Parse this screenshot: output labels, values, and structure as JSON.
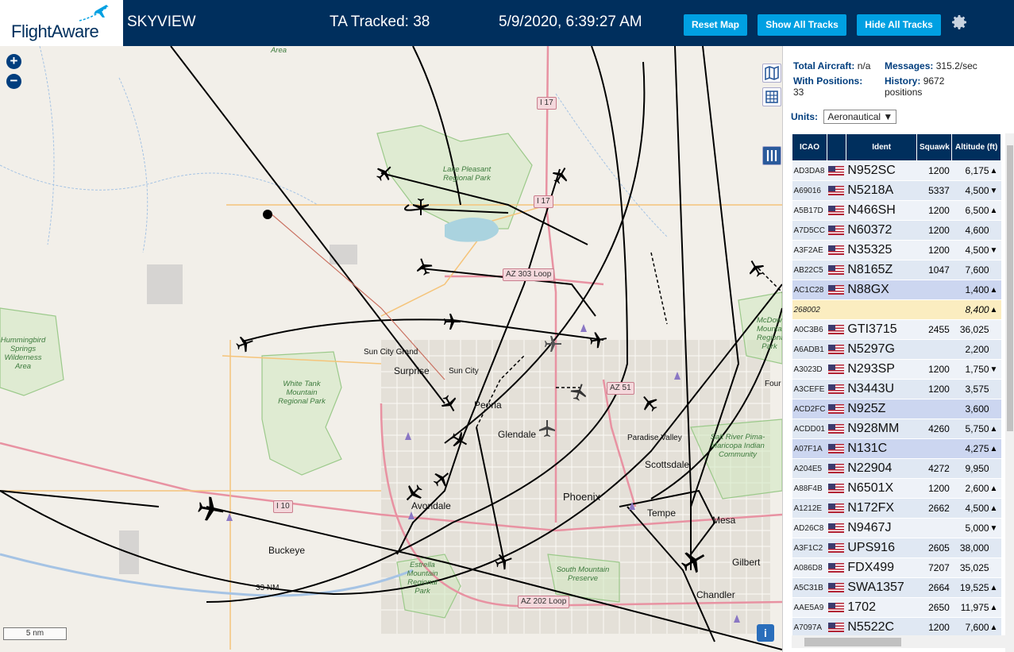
{
  "header": {
    "logo_text": "FlightAware",
    "app_title": "SKYVIEW",
    "tracked": "TA Tracked: 38",
    "datetime": "5/9/2020, 6:39:27 AM",
    "buttons": {
      "reset": "Reset Map",
      "show_all": "Show All Tracks",
      "hide_all": "Hide All Tracks"
    }
  },
  "map": {
    "zoom_in": "+",
    "zoom_out": "−",
    "scale_label": "5 nm",
    "range_label": "33 NM",
    "info": "i",
    "places": [
      "Surprise",
      "Sun City",
      "Sun City Grand",
      "Peoria",
      "Glendale",
      "Phoenix",
      "Tempe",
      "Mesa",
      "Scottsdale",
      "Paradise Valley",
      "Gilbert",
      "Chandler",
      "Buckeye",
      "Avondale",
      "Four"
    ],
    "parks": [
      "Lake Pleasant Regional Park",
      "White Tank Mountain Regional Park",
      "Hummingbird Springs Wilderness Area",
      "Estrella Mountain Regional Park",
      "South Mountain Preserve",
      "Salt River Pima-Maricopa Indian Community",
      "McDowell Mountain Regional Park",
      "Area"
    ],
    "roads": [
      "I 17",
      "I 17",
      "AZ 303 Loop",
      "AZ 51",
      "I 10",
      "AZ 202 Loop"
    ]
  },
  "panel": {
    "total_aircraft_label": "Total Aircraft:",
    "total_aircraft_value": "n/a",
    "messages_label": "Messages:",
    "messages_value": "315.2/sec",
    "with_positions_label": "With Positions:",
    "with_positions_value": "33",
    "history_label": "History:",
    "history_value": "9672 positions",
    "units_label": "Units:",
    "units_value": "Aeronautical ▼",
    "columns": [
      "ICAO",
      "Ident",
      "Squawk",
      "Altitude (ft)"
    ],
    "rows": [
      {
        "icao": "AD3DA8",
        "ident": "N952SC",
        "squawk": "1200",
        "alt": "6,175",
        "trend": "▲"
      },
      {
        "icao": "A69016",
        "ident": "N5218A",
        "squawk": "5337",
        "alt": "4,500",
        "trend": "▼"
      },
      {
        "icao": "A5B17D",
        "ident": "N466SH",
        "squawk": "1200",
        "alt": "6,500",
        "trend": "▲"
      },
      {
        "icao": "A7D5CC",
        "ident": "N60372",
        "squawk": "1200",
        "alt": "4,600",
        "trend": ""
      },
      {
        "icao": "A3F2AE",
        "ident": "N35325",
        "squawk": "1200",
        "alt": "4,500",
        "trend": "▼"
      },
      {
        "icao": "AB22C5",
        "ident": "N8165Z",
        "squawk": "1047",
        "alt": "7,600",
        "trend": ""
      },
      {
        "icao": "AC1C28",
        "ident": "N88GX",
        "squawk": "",
        "alt": "1,400",
        "trend": "▲"
      },
      {
        "icao": "268002",
        "ident": "",
        "squawk": "",
        "alt": "8,400",
        "trend": "▲"
      },
      {
        "icao": "A0C3B6",
        "ident": "GTI3715",
        "squawk": "2455",
        "alt": "36,025",
        "trend": ""
      },
      {
        "icao": "A6ADB1",
        "ident": "N5297G",
        "squawk": "",
        "alt": "2,200",
        "trend": ""
      },
      {
        "icao": "A3023D",
        "ident": "N293SP",
        "squawk": "1200",
        "alt": "1,750",
        "trend": "▼"
      },
      {
        "icao": "A3CEFE",
        "ident": "N3443U",
        "squawk": "1200",
        "alt": "3,575",
        "trend": ""
      },
      {
        "icao": "ACD2FC",
        "ident": "N925Z",
        "squawk": "",
        "alt": "3,600",
        "trend": ""
      },
      {
        "icao": "ACDD01",
        "ident": "N928MM",
        "squawk": "4260",
        "alt": "5,750",
        "trend": "▲"
      },
      {
        "icao": "A07F1A",
        "ident": "N131C",
        "squawk": "",
        "alt": "4,275",
        "trend": "▲"
      },
      {
        "icao": "A204E5",
        "ident": "N22904",
        "squawk": "4272",
        "alt": "9,950",
        "trend": ""
      },
      {
        "icao": "A88F4B",
        "ident": "N6501X",
        "squawk": "1200",
        "alt": "2,600",
        "trend": "▲"
      },
      {
        "icao": "A1212E",
        "ident": "N172FX",
        "squawk": "2662",
        "alt": "4,500",
        "trend": "▲"
      },
      {
        "icao": "AD26C8",
        "ident": "N9467J",
        "squawk": "",
        "alt": "5,000",
        "trend": "▼"
      },
      {
        "icao": "A3F1C2",
        "ident": "UPS916",
        "squawk": "2605",
        "alt": "38,000",
        "trend": ""
      },
      {
        "icao": "A086D8",
        "ident": "FDX499",
        "squawk": "7207",
        "alt": "35,025",
        "trend": ""
      },
      {
        "icao": "A5C31B",
        "ident": "SWA1357",
        "squawk": "2664",
        "alt": "19,525",
        "trend": "▲"
      },
      {
        "icao": "AAE5A9",
        "ident": "1702",
        "squawk": "2650",
        "alt": "11,975",
        "trend": "▲"
      },
      {
        "icao": "A7097A",
        "ident": "N5522C",
        "squawk": "1200",
        "alt": "7,600",
        "trend": "▲"
      }
    ]
  },
  "colors": {
    "header_bg": "#002f5d",
    "button_bg": "#00a0e2",
    "selected_row": "#ccd6f0",
    "highlight_row": "#fbedc0"
  }
}
